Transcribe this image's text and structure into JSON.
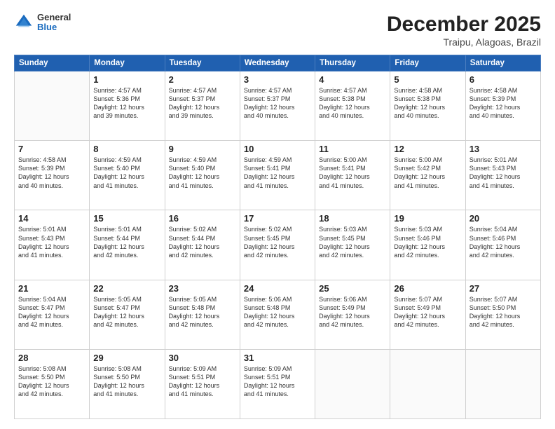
{
  "header": {
    "logo": {
      "general": "General",
      "blue": "Blue"
    },
    "title": "December 2025",
    "subtitle": "Traipu, Alagoas, Brazil"
  },
  "weekdays": [
    "Sunday",
    "Monday",
    "Tuesday",
    "Wednesday",
    "Thursday",
    "Friday",
    "Saturday"
  ],
  "weeks": [
    [
      {
        "day": "",
        "content": ""
      },
      {
        "day": "1",
        "content": "Sunrise: 4:57 AM\nSunset: 5:36 PM\nDaylight: 12 hours\nand 39 minutes."
      },
      {
        "day": "2",
        "content": "Sunrise: 4:57 AM\nSunset: 5:37 PM\nDaylight: 12 hours\nand 39 minutes."
      },
      {
        "day": "3",
        "content": "Sunrise: 4:57 AM\nSunset: 5:37 PM\nDaylight: 12 hours\nand 40 minutes."
      },
      {
        "day": "4",
        "content": "Sunrise: 4:57 AM\nSunset: 5:38 PM\nDaylight: 12 hours\nand 40 minutes."
      },
      {
        "day": "5",
        "content": "Sunrise: 4:58 AM\nSunset: 5:38 PM\nDaylight: 12 hours\nand 40 minutes."
      },
      {
        "day": "6",
        "content": "Sunrise: 4:58 AM\nSunset: 5:39 PM\nDaylight: 12 hours\nand 40 minutes."
      }
    ],
    [
      {
        "day": "7",
        "content": "Sunrise: 4:58 AM\nSunset: 5:39 PM\nDaylight: 12 hours\nand 40 minutes."
      },
      {
        "day": "8",
        "content": "Sunrise: 4:59 AM\nSunset: 5:40 PM\nDaylight: 12 hours\nand 41 minutes."
      },
      {
        "day": "9",
        "content": "Sunrise: 4:59 AM\nSunset: 5:40 PM\nDaylight: 12 hours\nand 41 minutes."
      },
      {
        "day": "10",
        "content": "Sunrise: 4:59 AM\nSunset: 5:41 PM\nDaylight: 12 hours\nand 41 minutes."
      },
      {
        "day": "11",
        "content": "Sunrise: 5:00 AM\nSunset: 5:41 PM\nDaylight: 12 hours\nand 41 minutes."
      },
      {
        "day": "12",
        "content": "Sunrise: 5:00 AM\nSunset: 5:42 PM\nDaylight: 12 hours\nand 41 minutes."
      },
      {
        "day": "13",
        "content": "Sunrise: 5:01 AM\nSunset: 5:43 PM\nDaylight: 12 hours\nand 41 minutes."
      }
    ],
    [
      {
        "day": "14",
        "content": "Sunrise: 5:01 AM\nSunset: 5:43 PM\nDaylight: 12 hours\nand 41 minutes."
      },
      {
        "day": "15",
        "content": "Sunrise: 5:01 AM\nSunset: 5:44 PM\nDaylight: 12 hours\nand 42 minutes."
      },
      {
        "day": "16",
        "content": "Sunrise: 5:02 AM\nSunset: 5:44 PM\nDaylight: 12 hours\nand 42 minutes."
      },
      {
        "day": "17",
        "content": "Sunrise: 5:02 AM\nSunset: 5:45 PM\nDaylight: 12 hours\nand 42 minutes."
      },
      {
        "day": "18",
        "content": "Sunrise: 5:03 AM\nSunset: 5:45 PM\nDaylight: 12 hours\nand 42 minutes."
      },
      {
        "day": "19",
        "content": "Sunrise: 5:03 AM\nSunset: 5:46 PM\nDaylight: 12 hours\nand 42 minutes."
      },
      {
        "day": "20",
        "content": "Sunrise: 5:04 AM\nSunset: 5:46 PM\nDaylight: 12 hours\nand 42 minutes."
      }
    ],
    [
      {
        "day": "21",
        "content": "Sunrise: 5:04 AM\nSunset: 5:47 PM\nDaylight: 12 hours\nand 42 minutes."
      },
      {
        "day": "22",
        "content": "Sunrise: 5:05 AM\nSunset: 5:47 PM\nDaylight: 12 hours\nand 42 minutes."
      },
      {
        "day": "23",
        "content": "Sunrise: 5:05 AM\nSunset: 5:48 PM\nDaylight: 12 hours\nand 42 minutes."
      },
      {
        "day": "24",
        "content": "Sunrise: 5:06 AM\nSunset: 5:48 PM\nDaylight: 12 hours\nand 42 minutes."
      },
      {
        "day": "25",
        "content": "Sunrise: 5:06 AM\nSunset: 5:49 PM\nDaylight: 12 hours\nand 42 minutes."
      },
      {
        "day": "26",
        "content": "Sunrise: 5:07 AM\nSunset: 5:49 PM\nDaylight: 12 hours\nand 42 minutes."
      },
      {
        "day": "27",
        "content": "Sunrise: 5:07 AM\nSunset: 5:50 PM\nDaylight: 12 hours\nand 42 minutes."
      }
    ],
    [
      {
        "day": "28",
        "content": "Sunrise: 5:08 AM\nSunset: 5:50 PM\nDaylight: 12 hours\nand 42 minutes."
      },
      {
        "day": "29",
        "content": "Sunrise: 5:08 AM\nSunset: 5:50 PM\nDaylight: 12 hours\nand 41 minutes."
      },
      {
        "day": "30",
        "content": "Sunrise: 5:09 AM\nSunset: 5:51 PM\nDaylight: 12 hours\nand 41 minutes."
      },
      {
        "day": "31",
        "content": "Sunrise: 5:09 AM\nSunset: 5:51 PM\nDaylight: 12 hours\nand 41 minutes."
      },
      {
        "day": "",
        "content": ""
      },
      {
        "day": "",
        "content": ""
      },
      {
        "day": "",
        "content": ""
      }
    ]
  ]
}
